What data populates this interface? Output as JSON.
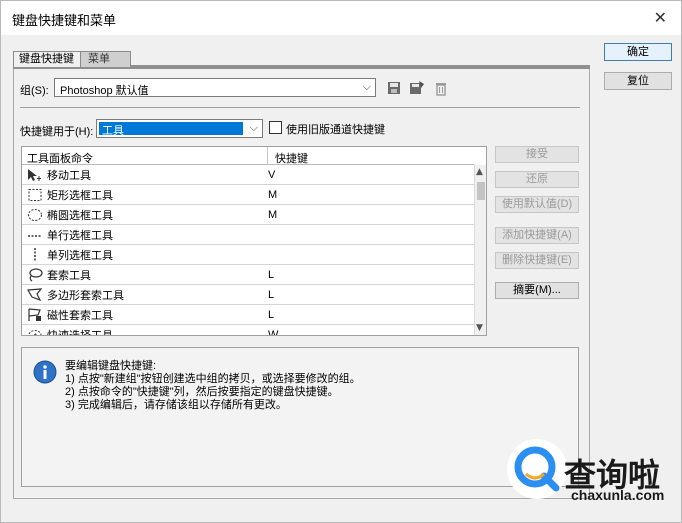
{
  "dialog": {
    "title": "键盘快捷键和菜单",
    "close_glyph": "✕"
  },
  "tabs": [
    {
      "label": "键盘快捷键"
    },
    {
      "label": "菜单"
    }
  ],
  "group": {
    "label": "组(S):",
    "value": "Photoshop 默认值",
    "caret": "⌵"
  },
  "shortcuts_for": {
    "label": "快捷键用于(H):",
    "value": "工具",
    "caret": "⌵",
    "legacy_label": "使用旧版通道快捷键",
    "legacy_checked": false
  },
  "table": {
    "columns": [
      "工具面板命令",
      "快捷键"
    ],
    "rows": [
      {
        "cmd": "移动工具",
        "key": "V",
        "icon": "move-tool-icon"
      },
      {
        "cmd": "矩形选框工具",
        "key": "M",
        "icon": "rect-marquee-icon"
      },
      {
        "cmd": "椭圆选框工具",
        "key": "M",
        "icon": "ellipse-marquee-icon"
      },
      {
        "cmd": "单行选框工具",
        "key": "",
        "icon": "single-row-marquee-icon"
      },
      {
        "cmd": "单列选框工具",
        "key": "",
        "icon": "single-column-marquee-icon"
      },
      {
        "cmd": "套索工具",
        "key": "L",
        "icon": "lasso-icon"
      },
      {
        "cmd": "多边形套索工具",
        "key": "L",
        "icon": "polygon-lasso-icon"
      },
      {
        "cmd": "磁性套索工具",
        "key": "L",
        "icon": "magnetic-lasso-icon"
      },
      {
        "cmd": "快速选择工具",
        "key": "W",
        "icon": "quick-selection-icon"
      }
    ]
  },
  "side_buttons": {
    "accept": "接受",
    "undo": "还原",
    "use_default": "使用默认值(D)",
    "add_shortcut": "添加快捷键(A)",
    "delete_shortcut": "删除快捷键(E)",
    "summarize": "摘要(M)..."
  },
  "dialog_buttons": {
    "ok": "确定",
    "reset": "复位"
  },
  "info": {
    "lines": [
      "要编辑键盘快捷键:",
      "1) 点按\"新建组\"按钮创建选中组的拷贝，或选择要修改的组。",
      "2) 点按命令的\"快捷键\"列，然后按要指定的键盘快捷键。",
      "3) 完成编辑后，请存储该组以存储所有更改。"
    ]
  },
  "watermark": {
    "brand": "查询啦",
    "url": "chaxunla.com"
  },
  "colors": {
    "selection": "#0078d7",
    "info_icon": "#2e73c6",
    "watermark_ring": "#2a8ff0",
    "watermark_accent": "#f5a623"
  }
}
